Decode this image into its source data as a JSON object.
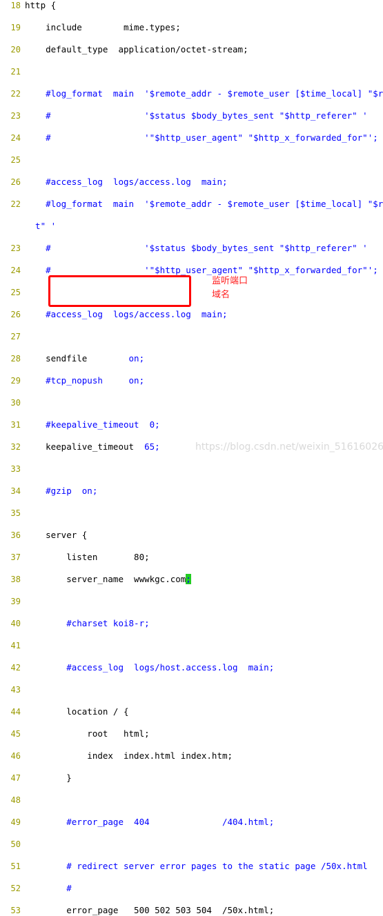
{
  "editor": {
    "name": "nginx-conf-code-view",
    "language": "nginx",
    "font_size_px": 12.5,
    "line_height_px": 16,
    "colors": {
      "background": "#ffffff",
      "gutter_text": "#9a9a00",
      "plain_text": "#000000",
      "comment_text": "#0000ff",
      "annotation_red": "#ff2020",
      "box_border": "#ff0000",
      "cursor_highlight": "#22cc22",
      "watermark": "#d9d9d9"
    }
  },
  "lines": [
    {
      "num": "18",
      "segments": [
        {
          "t": "http {",
          "c": "plain"
        }
      ]
    },
    {
      "num": "19",
      "segments": [
        {
          "t": "    include        mime.types;",
          "c": "plain"
        }
      ]
    },
    {
      "num": "20",
      "segments": [
        {
          "t": "    default_type  application/octet-stream;",
          "c": "plain"
        }
      ]
    },
    {
      "num": "21",
      "segments": [
        {
          "t": "",
          "c": "plain"
        }
      ]
    },
    {
      "num": "22",
      "segments": [
        {
          "t": "    #log_format  main  '$remote_addr - $remote_user [$time_local] \"$reques",
          "c": "cmt"
        }
      ]
    },
    {
      "num": "23",
      "segments": [
        {
          "t": "    #                  '$status $body_bytes_sent \"$http_referer\" '",
          "c": "cmt"
        }
      ]
    },
    {
      "num": "24",
      "segments": [
        {
          "t": "    #                  '\"$http_user_agent\" \"$http_x_forwarded_for\"';",
          "c": "cmt"
        }
      ]
    },
    {
      "num": "25",
      "segments": [
        {
          "t": "",
          "c": "plain"
        }
      ]
    },
    {
      "num": "26",
      "segments": [
        {
          "t": "    #access_log  logs/access.log  main;",
          "c": "cmt"
        }
      ]
    },
    {
      "num": "22",
      "segments": [
        {
          "t": "    #log_format  main  '$remote_addr - $remote_user [$time_local] \"$reques",
          "c": "cmt"
        }
      ]
    },
    {
      "num": "",
      "segments": [
        {
          "t": "  t\" '",
          "c": "cmt"
        }
      ]
    },
    {
      "num": "23",
      "segments": [
        {
          "t": "    #                  '$status $body_bytes_sent \"$http_referer\" '",
          "c": "cmt"
        }
      ]
    },
    {
      "num": "24",
      "segments": [
        {
          "t": "    #                  '\"$http_user_agent\" \"$http_x_forwarded_for\"';",
          "c": "cmt"
        }
      ]
    },
    {
      "num": "25",
      "segments": [
        {
          "t": "",
          "c": "plain"
        }
      ]
    },
    {
      "num": "26",
      "segments": [
        {
          "t": "    #access_log  logs/access.log  main;",
          "c": "cmt"
        }
      ]
    },
    {
      "num": "27",
      "segments": [
        {
          "t": "",
          "c": "plain"
        }
      ]
    },
    {
      "num": "28",
      "segments": [
        {
          "t": "    sendfile        ",
          "c": "plain"
        },
        {
          "t": "on;",
          "c": "val"
        }
      ]
    },
    {
      "num": "29",
      "segments": [
        {
          "t": "    #tcp_nopush     on;",
          "c": "cmt"
        }
      ]
    },
    {
      "num": "30",
      "segments": [
        {
          "t": "",
          "c": "plain"
        }
      ]
    },
    {
      "num": "31",
      "segments": [
        {
          "t": "    #keepalive_timeout  0;",
          "c": "cmt"
        }
      ]
    },
    {
      "num": "32",
      "segments": [
        {
          "t": "    keepalive_timeout  ",
          "c": "plain"
        },
        {
          "t": "65;",
          "c": "val"
        }
      ]
    },
    {
      "num": "33",
      "segments": [
        {
          "t": "",
          "c": "plain"
        }
      ]
    },
    {
      "num": "34",
      "segments": [
        {
          "t": "    #gzip  on;",
          "c": "cmt"
        }
      ]
    },
    {
      "num": "35",
      "segments": [
        {
          "t": "",
          "c": "plain"
        }
      ]
    },
    {
      "num": "36",
      "segments": [
        {
          "t": "    server {",
          "c": "plain"
        }
      ]
    },
    {
      "num": "37",
      "segments": [
        {
          "t": "        listen       80;",
          "c": "plain"
        }
      ]
    },
    {
      "num": "38",
      "segments": [
        {
          "t": "        server_name  wwwkgc.com",
          "c": "plain"
        },
        {
          "t": ";",
          "c": "cursor"
        }
      ]
    },
    {
      "num": "39",
      "segments": [
        {
          "t": "",
          "c": "plain"
        }
      ]
    },
    {
      "num": "40",
      "segments": [
        {
          "t": "        #charset koi8-r;",
          "c": "cmt"
        }
      ]
    },
    {
      "num": "41",
      "segments": [
        {
          "t": "",
          "c": "plain"
        }
      ]
    },
    {
      "num": "42",
      "segments": [
        {
          "t": "        #access_log  logs/host.access.log  main;",
          "c": "cmt"
        }
      ]
    },
    {
      "num": "43",
      "segments": [
        {
          "t": "",
          "c": "plain"
        }
      ]
    },
    {
      "num": "44",
      "segments": [
        {
          "t": "        location / {",
          "c": "plain"
        }
      ]
    },
    {
      "num": "45",
      "segments": [
        {
          "t": "            root   html;",
          "c": "plain"
        }
      ]
    },
    {
      "num": "46",
      "segments": [
        {
          "t": "            index  index.html index.htm;",
          "c": "plain"
        }
      ]
    },
    {
      "num": "47",
      "segments": [
        {
          "t": "        }",
          "c": "plain"
        }
      ]
    },
    {
      "num": "48",
      "segments": [
        {
          "t": "",
          "c": "plain"
        }
      ]
    },
    {
      "num": "49",
      "segments": [
        {
          "t": "        #error_page  404              /404.html;",
          "c": "cmt"
        }
      ]
    },
    {
      "num": "50",
      "segments": [
        {
          "t": "",
          "c": "plain"
        }
      ]
    },
    {
      "num": "51",
      "segments": [
        {
          "t": "        # redirect server error pages to the static page /50x.html",
          "c": "cmt"
        }
      ]
    },
    {
      "num": "52",
      "segments": [
        {
          "t": "        #",
          "c": "cmt"
        }
      ]
    },
    {
      "num": "53",
      "segments": [
        {
          "t": "        error_page   500 502 503 504  /50x.html;",
          "c": "plain"
        }
      ]
    }
  ],
  "annotations": {
    "listen_port_label": "监听端口",
    "server_name_label": "域名"
  },
  "watermark": {
    "text": "https://blog.csdn.net/weixin_51616026"
  }
}
